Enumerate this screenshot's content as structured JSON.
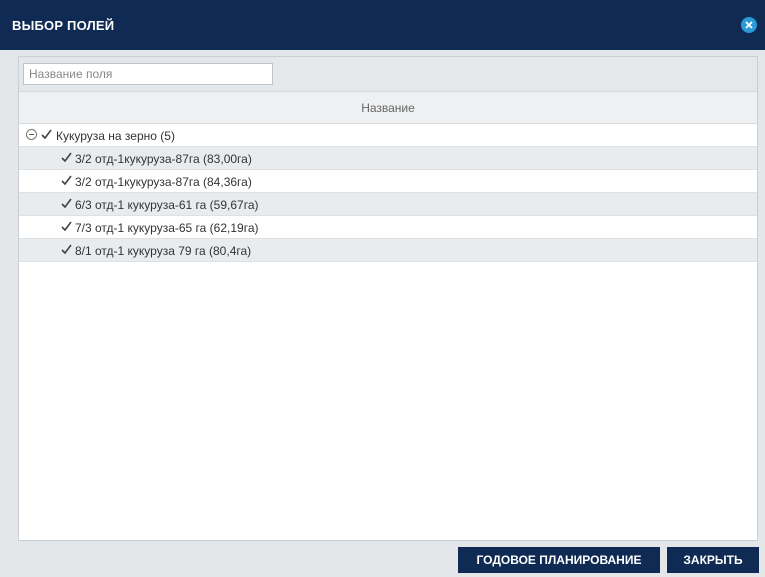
{
  "dialog": {
    "title": "ВЫБОР ПОЛЕЙ",
    "close_icon": "close-circle-icon"
  },
  "search": {
    "placeholder": "Название поля",
    "value": ""
  },
  "grid": {
    "column_header": "Название"
  },
  "tree": {
    "group": {
      "label": "Кукуруза на зерно (5)",
      "expanded": true,
      "checked": true
    },
    "items": [
      {
        "label": "3/2 отд-1кукуруза-87га (83,00га)",
        "checked": true
      },
      {
        "label": "3/2 отд-1кукуруза-87га (84,36га)",
        "checked": true
      },
      {
        "label": "6/3 отд-1 кукуруза-61 га (59,67га)",
        "checked": true
      },
      {
        "label": "7/3 отд-1 кукуруза-65 га (62,19га)",
        "checked": true
      },
      {
        "label": "8/1 отд-1 кукуруза 79 га (80,4га)",
        "checked": true
      }
    ]
  },
  "footer": {
    "plan_button": "ГОДОВОЕ ПЛАНИРОВАНИЕ",
    "close_button": "ЗАКРЫТЬ"
  },
  "colors": {
    "header_bg": "#0f2a53",
    "accent": "#2a9bd8",
    "button_bg": "#0f2a53"
  }
}
